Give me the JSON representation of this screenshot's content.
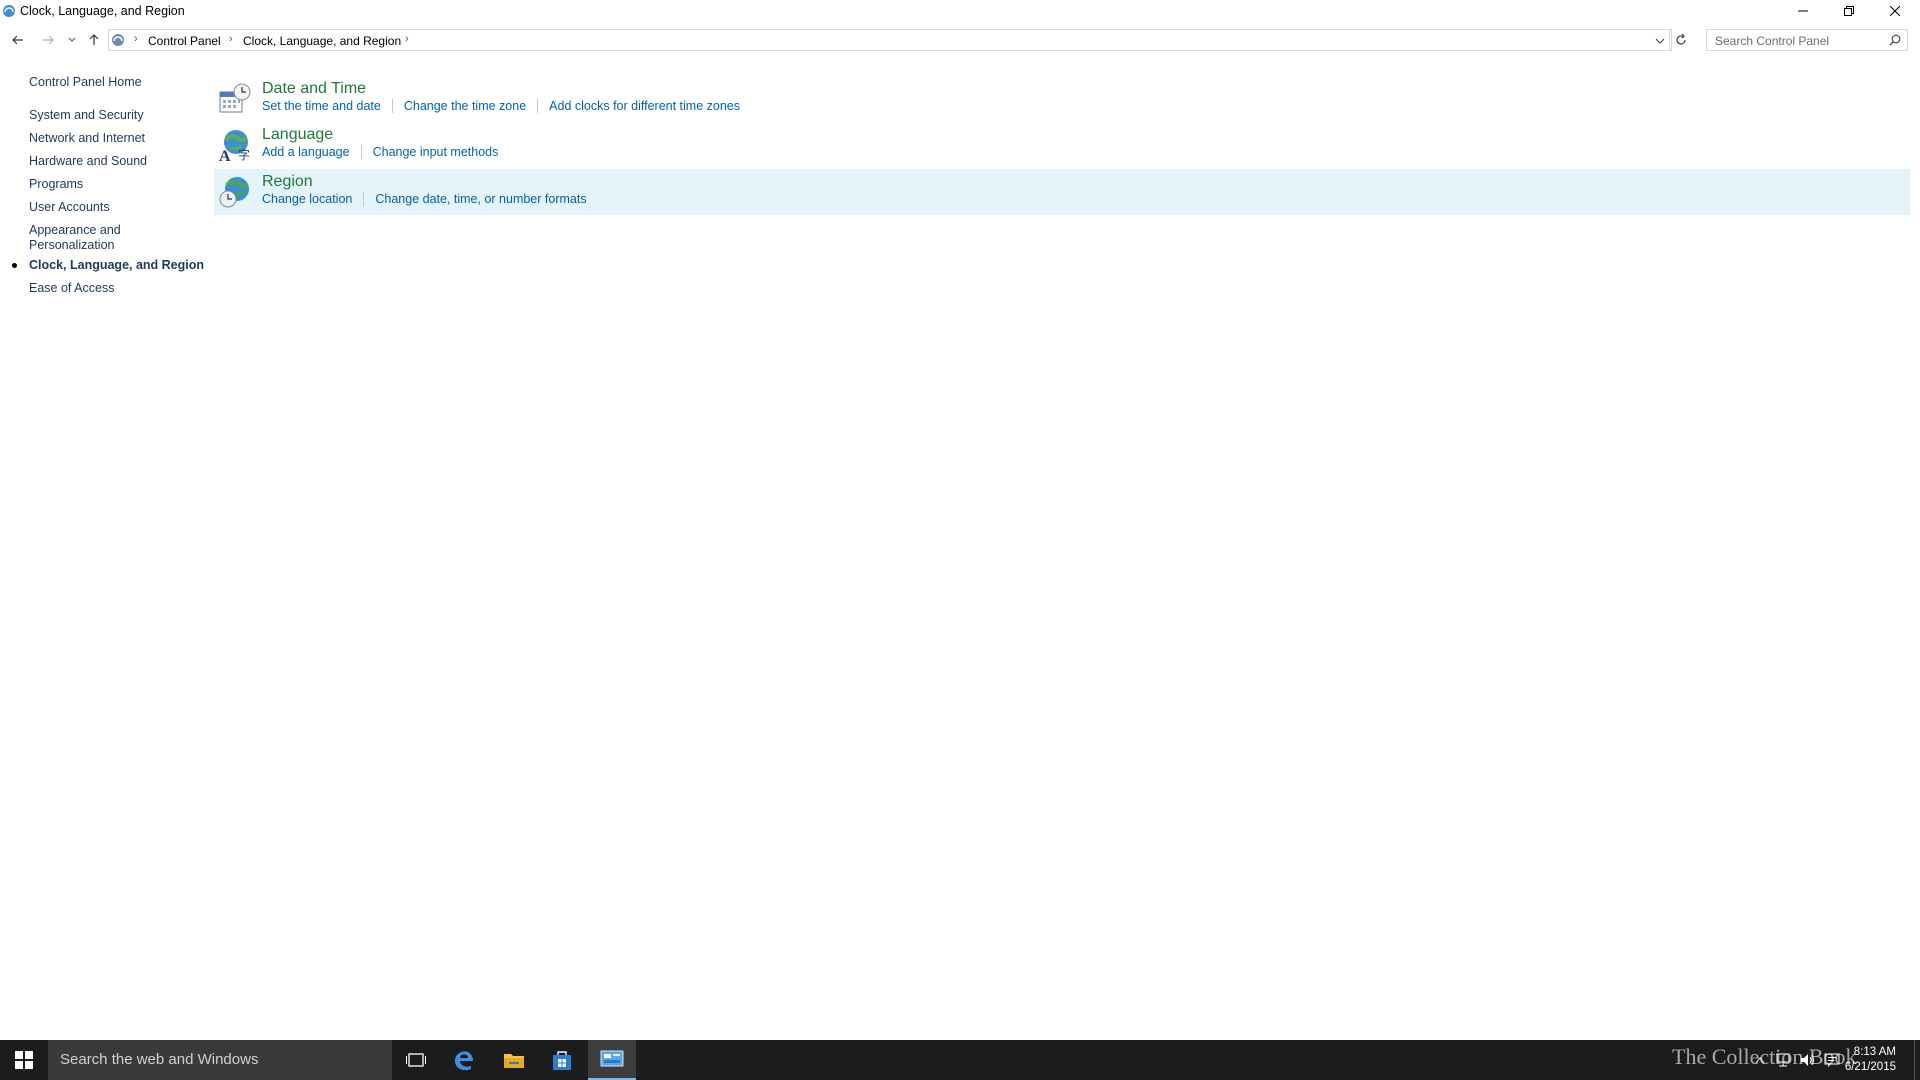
{
  "window": {
    "title": "Clock, Language, and Region",
    "controls": {
      "minimize": "minimize-icon",
      "restore": "restore-icon",
      "close": "close-icon"
    }
  },
  "address_bar": {
    "breadcrumbs": [
      "Control Panel",
      "Clock, Language, and Region"
    ],
    "search_placeholder": "Search Control Panel"
  },
  "sidebar": {
    "home": "Control Panel Home",
    "items": [
      {
        "label": "System and Security"
      },
      {
        "label": "Network and Internet"
      },
      {
        "label": "Hardware and Sound"
      },
      {
        "label": "Programs"
      },
      {
        "label": "User Accounts"
      },
      {
        "label": "Appearance and",
        "label2": "Personalization"
      },
      {
        "label": "Clock, Language, and Region",
        "current": true
      },
      {
        "label": "Ease of Access"
      }
    ]
  },
  "categories": [
    {
      "title": "Date and Time",
      "icon": "date-time-icon",
      "links": [
        "Set the time and date",
        "Change the time zone",
        "Add clocks for different time zones"
      ]
    },
    {
      "title": "Language",
      "icon": "language-icon",
      "links": [
        "Add a language",
        "Change input methods"
      ]
    },
    {
      "title": "Region",
      "icon": "region-globe-icon",
      "highlighted": true,
      "links": [
        "Change location",
        "Change date, time, or number formats"
      ]
    }
  ],
  "taskbar": {
    "search_text": "Search the web and Windows",
    "pinned": [
      "task-view-icon",
      "edge-icon",
      "file-explorer-icon",
      "store-icon",
      "control-panel-icon"
    ],
    "watermark": "The Collection Book",
    "time": "8:13 AM",
    "date": "6/21/2015"
  },
  "colors": {
    "link": "#0063b1",
    "category_title": "#1e7a3a",
    "sidebar_link": "#1e395b",
    "hover_row": "#e5f3fb",
    "taskbar": "#1c1c1c"
  }
}
